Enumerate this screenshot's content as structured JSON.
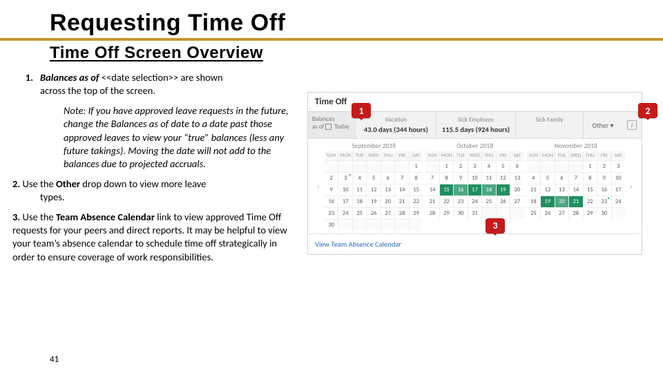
{
  "page": {
    "title": "Requesting Time Off",
    "subtitle": "Time Off Screen Overview",
    "page_number": "41"
  },
  "steps": {
    "s1": {
      "n": "1.",
      "lead": "Balances as of",
      "placeholder": "<<date selection>>",
      "tail1": "are shown",
      "tail2": "across the top of the screen."
    },
    "note": {
      "lead": "Note:",
      "body": "If you have approved leave requests in the future, change the Balances as of date to a date past those approved leaves to view your “true” balances (less any future takings). Moving the date will not add to the balances due to projected accruals."
    },
    "s2": {
      "n": "2.",
      "pre": "Use the ",
      "bold": "Other",
      "mid": " drop down to view more leave",
      "tail": "types."
    },
    "s3": {
      "n": "3.",
      "pre": "Use the ",
      "bold": "Team Absence Calendar",
      "mid": " link to view approved Time Off requests for your peers and direct reports. It may be helpful to view your team’s absence calendar to schedule time off strategically in order to ensure coverage of work responsibilities."
    }
  },
  "callouts": {
    "c1": "1",
    "c2": "2",
    "c3": "3"
  },
  "app": {
    "title": "Time Off",
    "balances": {
      "asof_label": "Balances",
      "asof_sub": "as of ",
      "asof_val": "Today",
      "cards": [
        {
          "label": "Vacation",
          "value": "43.0 days (344 hours)"
        },
        {
          "label": "Sick Employee",
          "value": "115.5 days (924 hours)"
        },
        {
          "label": "Sick Family",
          "value": ""
        }
      ],
      "other": "Other ▾",
      "info": "i"
    },
    "months": {
      "m1": "September 2018",
      "m2": "October 2018",
      "m3": "November 2018"
    },
    "dow": [
      "SUN",
      "MON",
      "TUE",
      "WED",
      "THU",
      "FRI",
      "SAT"
    ],
    "team_link": "View Team Absence Calendar"
  }
}
